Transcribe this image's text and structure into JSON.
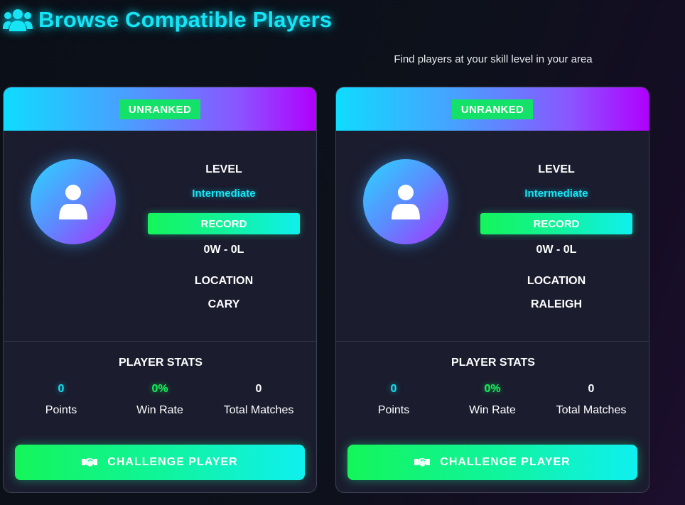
{
  "header": {
    "icon": "users-icon",
    "title": "Browse Compatible Players",
    "subtitle": "Find players at your skill level in your area"
  },
  "players": [
    {
      "rank_badge": "UNRANKED",
      "avatar_icon": "user-icon",
      "level_label": "LEVEL",
      "level": "Intermediate",
      "record_label": "RECORD",
      "record": "0W - 0L",
      "location_label": "LOCATION",
      "location": "CARY",
      "stats_title": "PLAYER STATS",
      "stats": [
        {
          "value": "0",
          "label": "Points"
        },
        {
          "value": "0%",
          "label": "Win Rate"
        },
        {
          "value": "0",
          "label": "Total Matches"
        }
      ],
      "challenge_icon": "handshake-icon",
      "challenge_label": "CHALLENGE PLAYER"
    },
    {
      "rank_badge": "UNRANKED",
      "avatar_icon": "user-icon",
      "level_label": "LEVEL",
      "level": "Intermediate",
      "record_label": "RECORD",
      "record": "0W - 0L",
      "location_label": "LOCATION",
      "location": "RALEIGH",
      "stats_title": "PLAYER STATS",
      "stats": [
        {
          "value": "0",
          "label": "Points"
        },
        {
          "value": "0%",
          "label": "Win Rate"
        },
        {
          "value": "0",
          "label": "Total Matches"
        }
      ],
      "challenge_icon": "handshake-icon",
      "challenge_label": "CHALLENGE PLAYER"
    }
  ],
  "colors": {
    "accent_cyan": "#16e4f4",
    "accent_green": "#14f55a",
    "card_bg": "#1b1c2e",
    "gradient_purple": "#b000ff"
  }
}
